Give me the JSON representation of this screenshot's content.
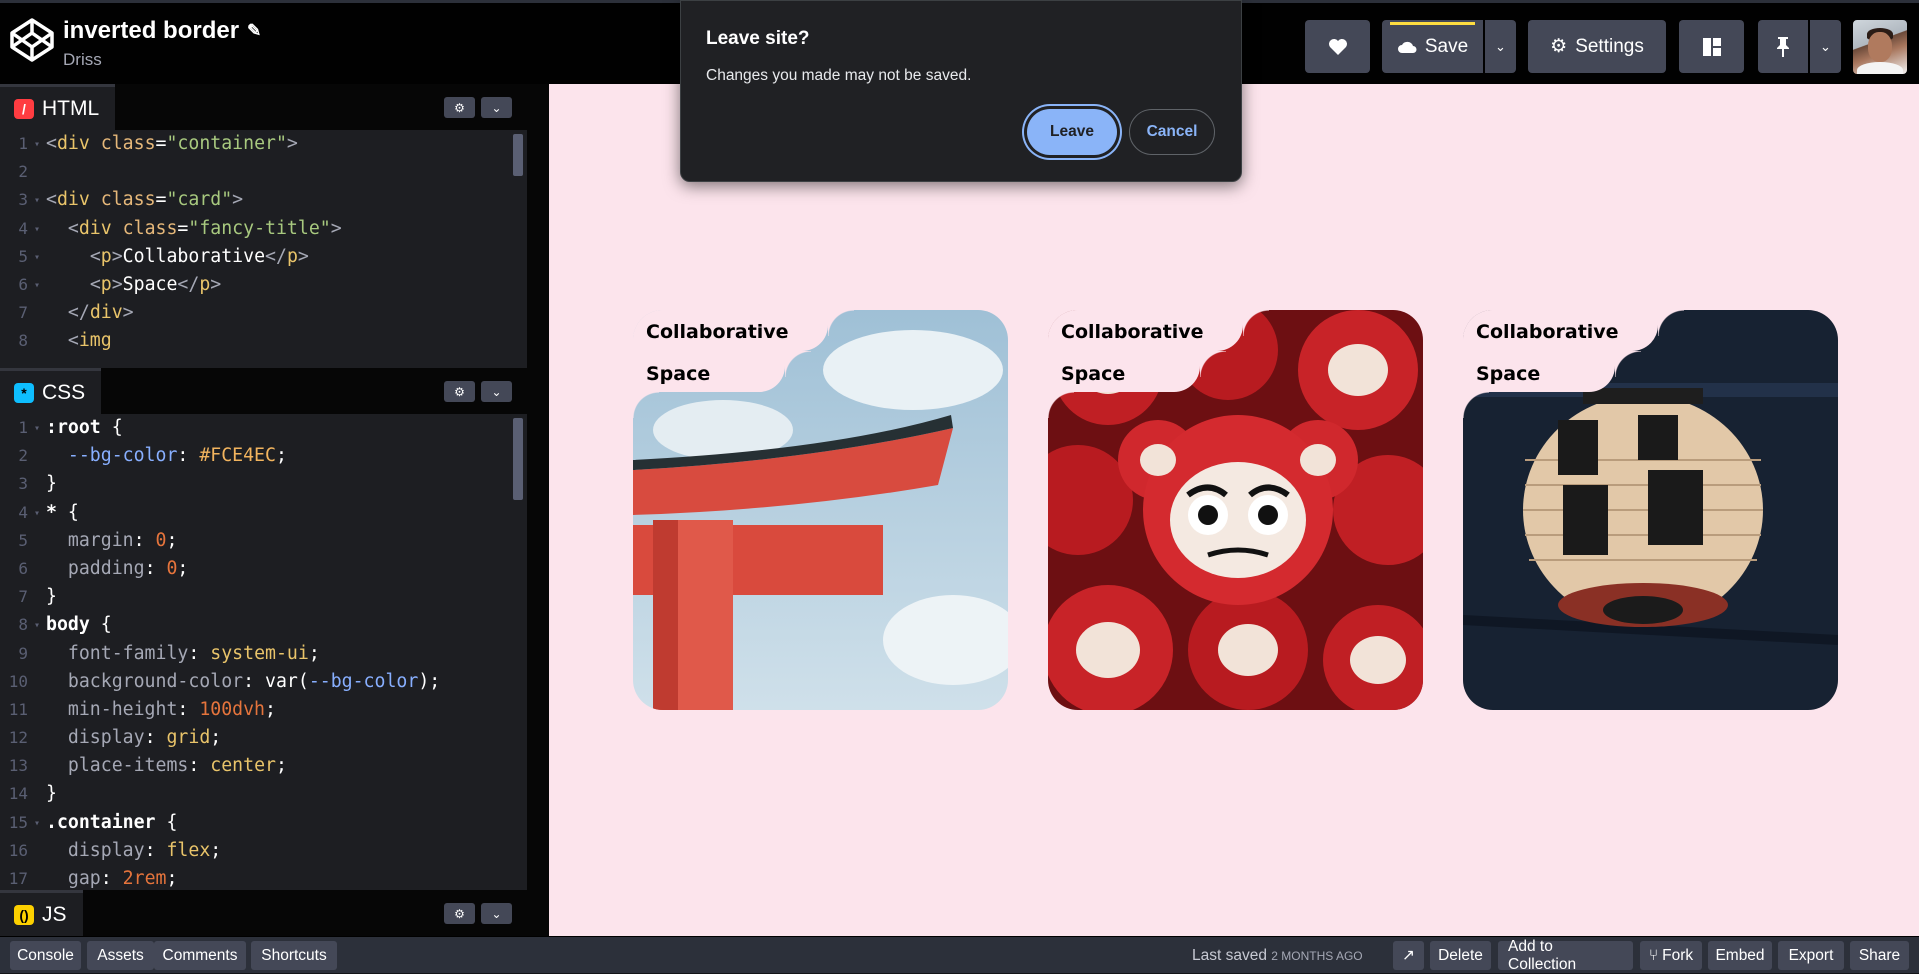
{
  "header": {
    "title": "inverted border",
    "author": "Driss",
    "edit_icon": "pencil-icon",
    "buttons": {
      "love_icon": "heart-icon",
      "save_label": "Save",
      "settings_label": "Settings",
      "layout_icon": "layout-icon",
      "pin_icon": "pin-icon"
    }
  },
  "editors": {
    "html": {
      "label": "HTML",
      "lines": [
        {
          "n": "1",
          "fold": "▾",
          "text": "<div class=\"container\">"
        },
        {
          "n": "2",
          "fold": "",
          "text": ""
        },
        {
          "n": "3",
          "fold": "▾",
          "text": "<div class=\"card\">"
        },
        {
          "n": "4",
          "fold": "▾",
          "text": "  <div class=\"fancy-title\">"
        },
        {
          "n": "5",
          "fold": "▾",
          "text": "    <p>Collaborative</p>"
        },
        {
          "n": "6",
          "fold": "▾",
          "text": "    <p>Space</p>"
        },
        {
          "n": "7",
          "fold": "",
          "text": "  </div>"
        },
        {
          "n": "8",
          "fold": "",
          "text": "  <img"
        }
      ]
    },
    "css": {
      "label": "CSS",
      "lines": [
        {
          "n": "1",
          "fold": "▾",
          "text": ":root {"
        },
        {
          "n": "2",
          "fold": "",
          "text": "  --bg-color: #FCE4EC;"
        },
        {
          "n": "3",
          "fold": "",
          "text": "}"
        },
        {
          "n": "4",
          "fold": "▾",
          "text": "* {"
        },
        {
          "n": "5",
          "fold": "",
          "text": "  margin: 0;"
        },
        {
          "n": "6",
          "fold": "",
          "text": "  padding: 0;"
        },
        {
          "n": "7",
          "fold": "",
          "text": "}"
        },
        {
          "n": "8",
          "fold": "▾",
          "text": "body {"
        },
        {
          "n": "9",
          "fold": "",
          "text": "  font-family: system-ui;"
        },
        {
          "n": "10",
          "fold": "",
          "text": "  background-color: var(--bg-color);"
        },
        {
          "n": "11",
          "fold": "",
          "text": "  min-height: 100dvh;"
        },
        {
          "n": "12",
          "fold": "",
          "text": "  display: grid;"
        },
        {
          "n": "13",
          "fold": "",
          "text": "  place-items: center;"
        },
        {
          "n": "14",
          "fold": "",
          "text": "}"
        },
        {
          "n": "15",
          "fold": "▾",
          "text": ".container {"
        },
        {
          "n": "16",
          "fold": "",
          "text": "  display: flex;"
        },
        {
          "n": "17",
          "fold": "",
          "text": "  gap: 2rem;"
        }
      ]
    },
    "js": {
      "label": "JS"
    }
  },
  "preview": {
    "cards": [
      {
        "line1": "Collaborative",
        "line2": "Space",
        "image": "torii-gate"
      },
      {
        "line1": "Collaborative",
        "line2": "Space",
        "image": "daruma-dolls"
      },
      {
        "line1": "Collaborative",
        "line2": "Space",
        "image": "paper-lantern"
      }
    ]
  },
  "dialog": {
    "title": "Leave site?",
    "message": "Changes you made may not be saved.",
    "leave_label": "Leave",
    "cancel_label": "Cancel"
  },
  "footer": {
    "console": "Console",
    "assets": "Assets",
    "comments": "Comments",
    "shortcuts": "Shortcuts",
    "last_saved": "Last saved",
    "last_saved_time": "2 months ago",
    "delete": "Delete",
    "add_to_collection": "Add to Collection",
    "fork": "Fork",
    "embed": "Embed",
    "export": "Export",
    "share": "Share"
  },
  "colors": {
    "accent_save": "#ffdd40",
    "preview_bg": "#fce4ec",
    "html_badge": "#ff3c41",
    "css_badge": "#0ebeff",
    "js_badge": "#fcd000",
    "leave_btn": "#8ab4f8"
  }
}
